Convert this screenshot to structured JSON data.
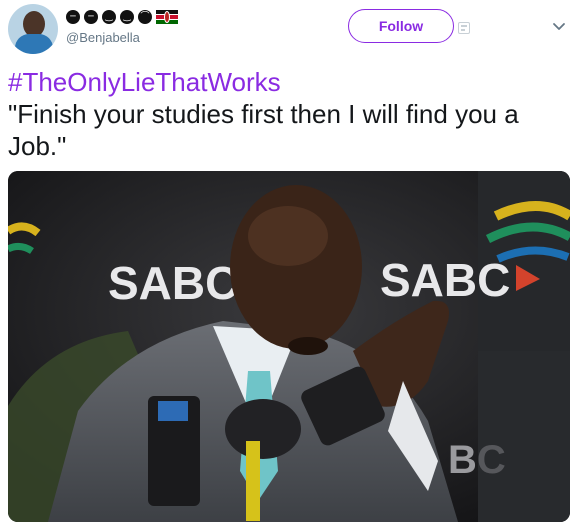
{
  "tweet": {
    "author": {
      "emoji_sequence": [
        "expressionless-face-emoji",
        "expressionless-face-emoji",
        "neutral-face-emoji",
        "neutral-face-emoji",
        "frowning-face-emoji"
      ],
      "flag": "kenya-flag",
      "handle": "@Benjabella"
    },
    "follow_label": "Follow",
    "hashtag": "#TheOnlyLieThatWorks",
    "text": "\"Finish your studies first then I will find you a Job.\"",
    "media": {
      "logo_left": "SABC",
      "logo_right": "SABC",
      "logo_bottom": "BC"
    }
  },
  "colors": {
    "accent": "#8a2be2",
    "text": "#14171a",
    "muted": "#657786"
  }
}
